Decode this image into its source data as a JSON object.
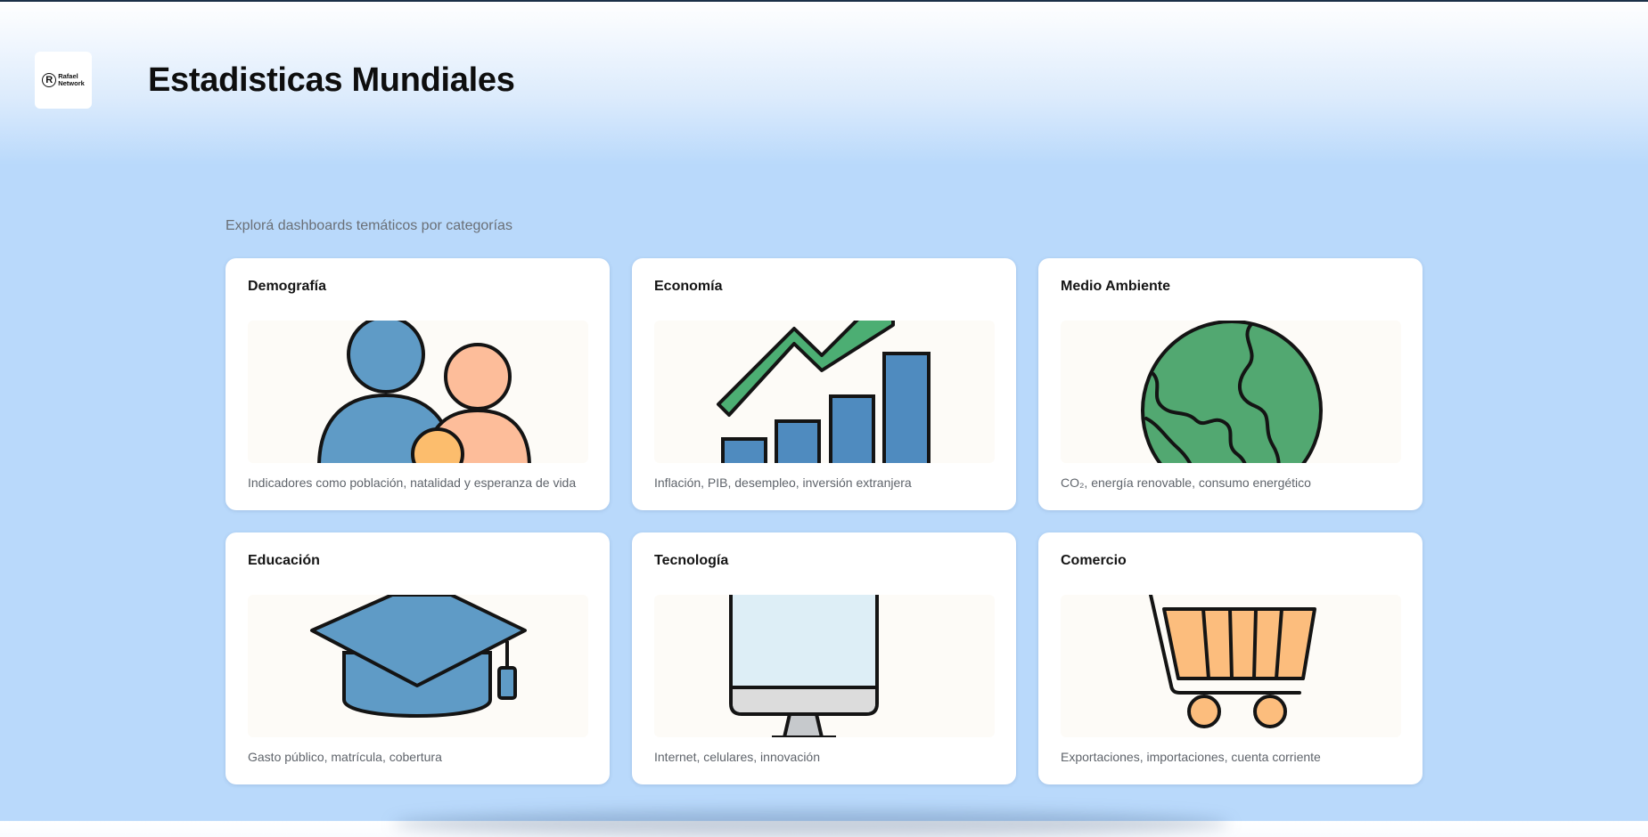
{
  "header": {
    "logo": {
      "icon": "registered-icon",
      "line1": "Rafael",
      "line2": "Network"
    },
    "title": "Estadisticas Mundiales"
  },
  "main": {
    "subtitle": "Explorá dashboards temáticos por categorías",
    "cards": [
      {
        "title": "Demografía",
        "description": "Indicadores como población, natalidad y esperanza de vida",
        "icon": "family-icon"
      },
      {
        "title": "Economía",
        "description": "Inflación, PIB, desempleo, inversión extranjera",
        "icon": "growth-chart-icon"
      },
      {
        "title": "Medio Ambiente",
        "description": "CO₂, energía renovable, consumo energético",
        "icon": "globe-icon"
      },
      {
        "title": "Educación",
        "description": "Gasto público, matrícula, cobertura",
        "icon": "graduation-cap-icon"
      },
      {
        "title": "Tecnología",
        "description": "Internet, celulares, innovación",
        "icon": "monitor-icon"
      },
      {
        "title": "Comercio",
        "description": "Exportaciones, importaciones, cuenta corriente",
        "icon": "shopping-cart-icon"
      }
    ]
  },
  "colors": {
    "background": "#b9d9fb",
    "card": "#ffffff",
    "blue": "#5f9bc6",
    "peach": "#fdbd9a",
    "green": "#52a871",
    "orange": "#fcbd7d"
  }
}
